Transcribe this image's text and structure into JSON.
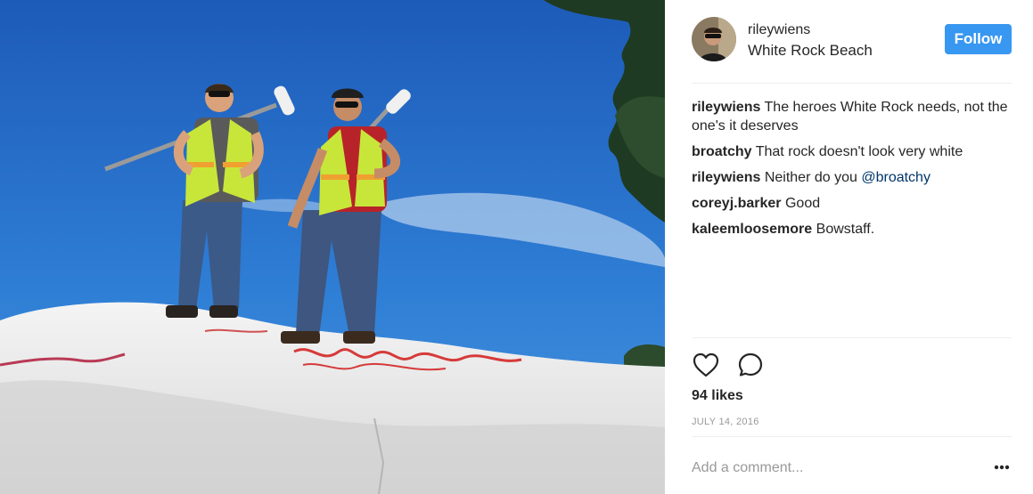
{
  "post": {
    "photo_description_icon": "photo",
    "author": {
      "username": "rileywiens",
      "location": "White Rock Beach",
      "avatar_icon": "avatar"
    },
    "follow_label": "Follow",
    "comments": [
      {
        "author": "rileywiens",
        "text": "The heroes White Rock needs, not the one's it deserves",
        "mention": ""
      },
      {
        "author": "broatchy",
        "text": "That rock doesn't look very white",
        "mention": ""
      },
      {
        "author": "rileywiens",
        "text": "Neither do you ",
        "mention": "@broatchy"
      },
      {
        "author": "coreyj.barker",
        "text": "Good",
        "mention": ""
      },
      {
        "author": "kaleemloosemore",
        "text": "Bowstaff.",
        "mention": ""
      }
    ],
    "likes": "94 likes",
    "date": "JULY 14, 2016",
    "add_comment_placeholder": "Add a comment...",
    "icons": {
      "like": "heart-icon",
      "comment": "comment-bubble-icon",
      "more": "more-options-icon"
    },
    "colors": {
      "follow_button": "#3897f0",
      "mention": "#003569",
      "divider": "#efefef",
      "muted": "#999999"
    }
  }
}
